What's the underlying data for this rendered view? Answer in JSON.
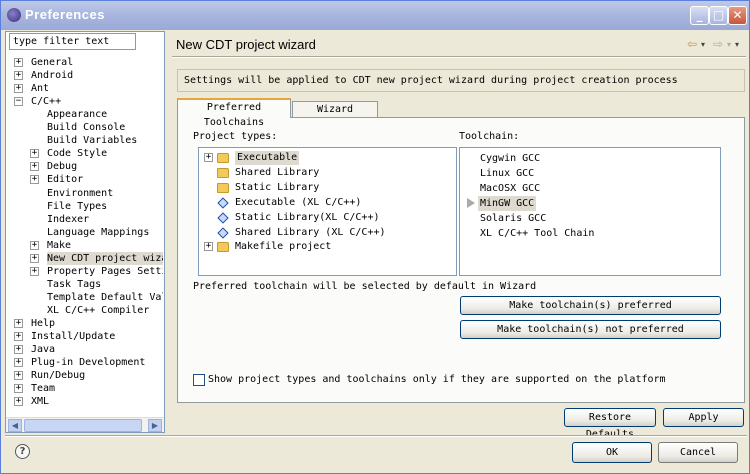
{
  "window": {
    "title": "Preferences",
    "minimize": "_",
    "maximize": "□",
    "close": "✕"
  },
  "filter": {
    "value": "type filter text"
  },
  "tree": [
    {
      "label": "General",
      "level": 0,
      "expander": "+"
    },
    {
      "label": "Android",
      "level": 0,
      "expander": "+"
    },
    {
      "label": "Ant",
      "level": 0,
      "expander": "+"
    },
    {
      "label": "C/C++",
      "level": 0,
      "expander": "−"
    },
    {
      "label": "Appearance",
      "level": 1,
      "expander": ""
    },
    {
      "label": "Build Console",
      "level": 1,
      "expander": ""
    },
    {
      "label": "Build Variables",
      "level": 1,
      "expander": ""
    },
    {
      "label": "Code Style",
      "level": 1,
      "expander": "+"
    },
    {
      "label": "Debug",
      "level": 1,
      "expander": "+"
    },
    {
      "label": "Editor",
      "level": 1,
      "expander": "+"
    },
    {
      "label": "Environment",
      "level": 1,
      "expander": ""
    },
    {
      "label": "File Types",
      "level": 1,
      "expander": ""
    },
    {
      "label": "Indexer",
      "level": 1,
      "expander": ""
    },
    {
      "label": "Language Mappings",
      "level": 1,
      "expander": ""
    },
    {
      "label": "Make",
      "level": 1,
      "expander": "+"
    },
    {
      "label": "New CDT project wizard",
      "level": 1,
      "expander": "+",
      "selected": true
    },
    {
      "label": "Property Pages Settings",
      "level": 1,
      "expander": "+"
    },
    {
      "label": "Task Tags",
      "level": 1,
      "expander": ""
    },
    {
      "label": "Template Default Values",
      "level": 1,
      "expander": ""
    },
    {
      "label": "XL C/C++ Compiler",
      "level": 1,
      "expander": ""
    },
    {
      "label": "Help",
      "level": 0,
      "expander": "+"
    },
    {
      "label": "Install/Update",
      "level": 0,
      "expander": "+"
    },
    {
      "label": "Java",
      "level": 0,
      "expander": "+"
    },
    {
      "label": "Plug-in Development",
      "level": 0,
      "expander": "+"
    },
    {
      "label": "Run/Debug",
      "level": 0,
      "expander": "+"
    },
    {
      "label": "Team",
      "level": 0,
      "expander": "+"
    },
    {
      "label": "XML",
      "level": 0,
      "expander": "+"
    }
  ],
  "page": {
    "title": "New CDT project wizard",
    "info": "Settings will be applied to CDT new project wizard during project creation process",
    "tabs": [
      "Preferred Toolchains",
      "Wizard Defaults"
    ],
    "project_types_label": "Project types:",
    "toolchain_label": "Toolchain:",
    "project_types": [
      {
        "label": "Executable",
        "icon": "folder-icon",
        "expander": "+",
        "selected": true
      },
      {
        "label": "Shared Library",
        "icon": "folder-icon",
        "expander": ""
      },
      {
        "label": "Static Library",
        "icon": "folder-icon",
        "expander": ""
      },
      {
        "label": "Executable (XL C/C++)",
        "icon": "diamond-icon",
        "expander": ""
      },
      {
        "label": "Static Library(XL C/C++)",
        "icon": "diamond-icon",
        "expander": ""
      },
      {
        "label": "Shared Library (XL C/C++)",
        "icon": "diamond-icon",
        "expander": ""
      },
      {
        "label": "Makefile project",
        "icon": "folder-icon",
        "expander": "+"
      }
    ],
    "toolchains": [
      {
        "label": "Cygwin GCC"
      },
      {
        "label": "Linux GCC"
      },
      {
        "label": "MacOSX GCC"
      },
      {
        "label": "MinGW GCC",
        "selected": true
      },
      {
        "label": "Solaris GCC"
      },
      {
        "label": "XL C/C++ Tool Chain"
      }
    ],
    "preferred_note": "Preferred toolchain will be selected by default in Wizard",
    "make_preferred": "Make toolchain(s) preferred",
    "make_not_preferred": "Make toolchain(s) not preferred",
    "show_supported": "Show project types and toolchains only if they are supported on the platform",
    "restore_defaults": "Restore Defaults",
    "apply": "Apply"
  },
  "footer": {
    "help": "?",
    "ok": "OK",
    "cancel": "Cancel"
  }
}
